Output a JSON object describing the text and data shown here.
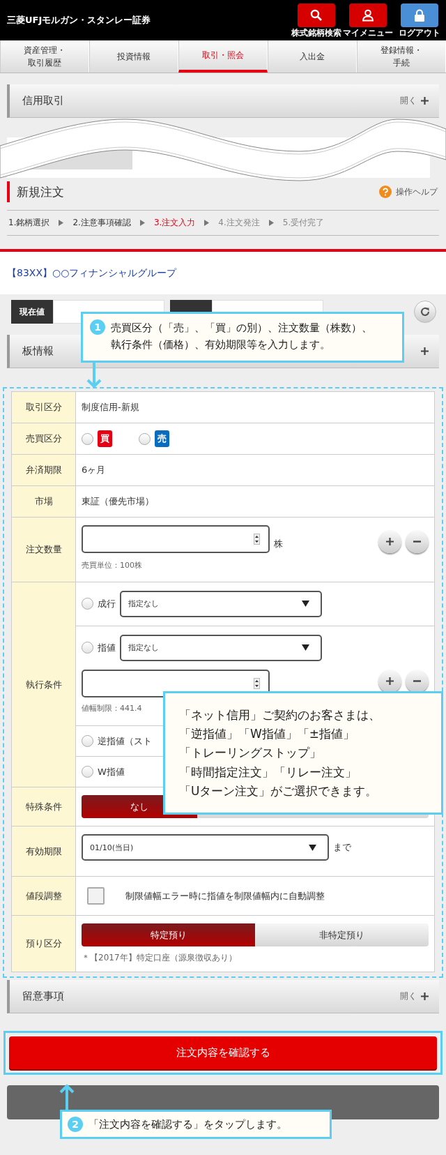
{
  "header": {
    "logo": "三菱UFJモルガン・スタンレー証券",
    "buttons": [
      {
        "kind": "search",
        "label": "株式銘柄検索"
      },
      {
        "kind": "user",
        "label": "マイメニュー"
      },
      {
        "kind": "lock",
        "label": "ログアウト"
      }
    ]
  },
  "nav": [
    {
      "lines": [
        "資産管理・",
        "取引履歴"
      ],
      "selected": false
    },
    {
      "lines": [
        "投資情報"
      ],
      "selected": false
    },
    {
      "lines": [
        "取引・照会"
      ],
      "selected": true
    },
    {
      "lines": [
        "入出金"
      ],
      "selected": false
    },
    {
      "lines": [
        "登録情報・",
        "手続"
      ],
      "selected": false
    }
  ],
  "credit_section": {
    "title": "信用取引",
    "toggle": "開く"
  },
  "order": {
    "title": "新規注文",
    "help": "操作ヘルプ"
  },
  "steps": [
    {
      "label": "1.銘柄選択",
      "done": true,
      "selected": false
    },
    {
      "label": "2.注意事項確認",
      "done": true,
      "selected": false
    },
    {
      "label": "3.注文入力",
      "done": false,
      "selected": true
    },
    {
      "label": "4.注文発注",
      "done": false,
      "selected": false
    },
    {
      "label": "5.受付完了",
      "done": false,
      "selected": false
    }
  ],
  "stock": "【83XX】○○フィナンシャルグループ",
  "quote": {
    "label": "現在値"
  },
  "board_section": {
    "title": "板情報"
  },
  "form": {
    "rows": [
      {
        "label": "取引区分",
        "kind": "text",
        "value": "制度信用-新規"
      },
      {
        "label": "売買区分",
        "kind": "side",
        "options": [
          {
            "label": "買",
            "color": "#e60012",
            "selected": false
          },
          {
            "label": "売",
            "color": "#0a6cc0",
            "selected": false
          }
        ]
      },
      {
        "label": "弁済期限",
        "kind": "text",
        "value": "6ヶ月"
      },
      {
        "label": "市場",
        "kind": "text",
        "value": "東証（優先市場）"
      },
      {
        "label": "注文数量",
        "kind": "quantity",
        "unit": "株",
        "note": "売買単位：100株"
      },
      {
        "label": "執行条件",
        "kind": "execution",
        "options": [
          {
            "kind": "select",
            "label": "成行",
            "selected": false,
            "select": "指定なし"
          },
          {
            "kind": "price",
            "label": "指値",
            "selected": false,
            "select": "指定なし",
            "note": "値幅制限：441.4"
          },
          {
            "kind": "plain",
            "label": "逆指値（スト",
            "selected": false
          },
          {
            "kind": "plain",
            "label": "W指値",
            "selected": false
          }
        ]
      },
      {
        "label": "特殊条件",
        "kind": "segments",
        "options": [
          {
            "label": "なし",
            "selected": true
          }
        ]
      },
      {
        "label": "有効期限",
        "kind": "select",
        "value": "01/10(当日)",
        "suffix": "まで"
      },
      {
        "label": "値段調整",
        "kind": "checkbox",
        "checked": false,
        "text": "制限値幅エラー時に指値を制限値幅内に自動調整"
      },
      {
        "label": "預り区分",
        "kind": "segments",
        "options": [
          {
            "label": "特定預り",
            "selected": true
          },
          {
            "label": "非特定預り",
            "selected": false
          }
        ],
        "note": "＊【2017年】特定口座（源泉徴収あり）"
      }
    ]
  },
  "notes_section": {
    "title": "留意事項",
    "toggle": "開く"
  },
  "confirm_button": "注文内容を確認する",
  "callouts": [
    {
      "number": "1",
      "lines": [
        "売買区分（「売」、「買」の別）、注文数量（株数）、",
        "執行条件（価格）、有効期限等を入力します。"
      ]
    },
    {
      "lines": [
        "「ネット信用」ご契約のお客さまは、",
        "「逆指値」「W指値」「±指値」",
        "「トレーリングストップ」",
        "「時間指定注文」「リレー注文」",
        "「Uターン注文」がご選択できます。"
      ]
    },
    {
      "number": "2",
      "lines": [
        "「注文内容を確認する」をタップします。"
      ]
    }
  ]
}
